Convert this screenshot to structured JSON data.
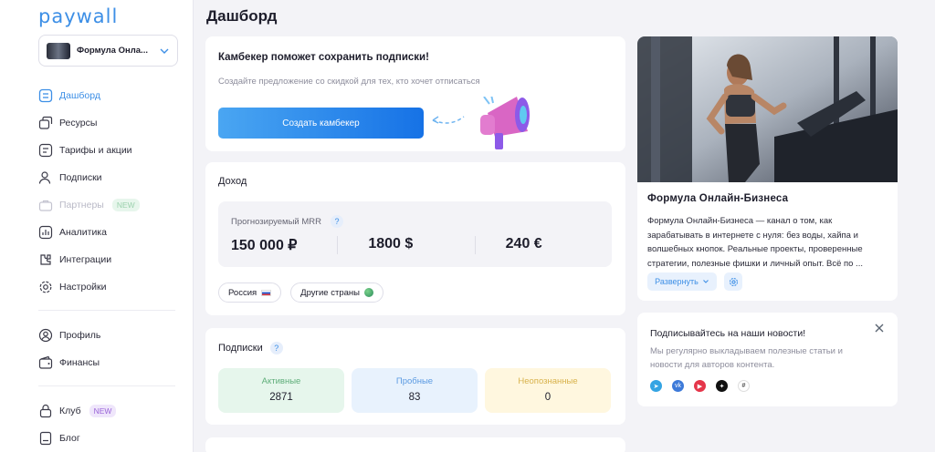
{
  "brand": {
    "logo": "paywall",
    "accent": "#3d8fe6"
  },
  "sidebar": {
    "project": {
      "name": "Формула Онла..."
    },
    "items": [
      {
        "label": "Дашборд",
        "icon": "dashboard-icon",
        "active": true
      },
      {
        "label": "Ресурсы",
        "icon": "resources-icon"
      },
      {
        "label": "Тарифы и акции",
        "icon": "tariffs-icon"
      },
      {
        "label": "Подписки",
        "icon": "subscriptions-icon"
      },
      {
        "label": "Партнеры",
        "icon": "partners-icon",
        "badge": "NEW",
        "muted": true
      },
      {
        "label": "Аналитика",
        "icon": "analytics-icon"
      },
      {
        "label": "Интеграции",
        "icon": "integrations-icon"
      },
      {
        "label": "Настройки",
        "icon": "settings-icon"
      }
    ],
    "items2": [
      {
        "label": "Профиль",
        "icon": "profile-icon"
      },
      {
        "label": "Финансы",
        "icon": "finance-icon"
      }
    ],
    "items3": [
      {
        "label": "Клуб",
        "icon": "club-icon",
        "badge": "NEW"
      },
      {
        "label": "Блог",
        "icon": "blog-icon"
      }
    ]
  },
  "page": {
    "title": "Дашборд"
  },
  "comeback": {
    "title": "Камбекер поможет сохранить подписки!",
    "subtitle": "Создайте предложение со скидкой для тех, кто хочет отписаться",
    "button": "Создать камбекер"
  },
  "income": {
    "title": "Доход",
    "mrr_label": "Прогнозируемый MRR",
    "help": "?",
    "values": [
      "150 000 ₽",
      "1800 $",
      "240 €"
    ],
    "chips": [
      "Россия",
      "Другие страны"
    ]
  },
  "subscriptions": {
    "title": "Подписки",
    "help": "?",
    "stats": [
      {
        "label": "Активные",
        "value": "2871",
        "color": "#e6f6ec"
      },
      {
        "label": "Пробные",
        "value": "83",
        "color": "#e8f2fd"
      },
      {
        "label": "Неопознанные",
        "value": "0",
        "color": "#fff7df"
      }
    ]
  },
  "project_card": {
    "title": "Формула Онлайн-Бизнеса",
    "description": "Формула Онлайн-Бизнеса — канал о том, как зарабатывать в интернете с нуля: без воды, хайпа и волшебных кнопок. Реальные проекты, проверенные стратегии, полезные фишки и личный опыт. Всё по ...",
    "expand_label": "Развернуть"
  },
  "news": {
    "title": "Подписывайтесь на наши новости!",
    "subtitle": "Мы регулярно выкладываем полезные статьи и новости для авторов контента.",
    "socials": [
      "telegram-icon",
      "vk-icon",
      "youtube-icon",
      "threads-icon",
      "tenchat-icon"
    ]
  }
}
